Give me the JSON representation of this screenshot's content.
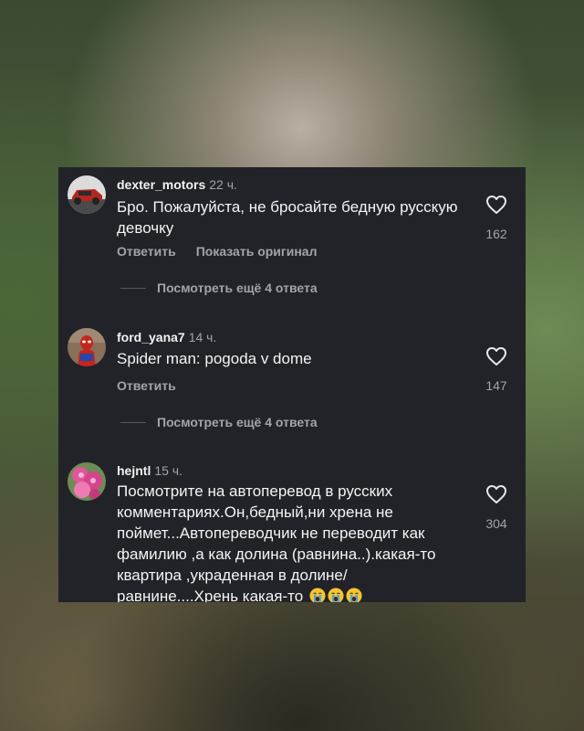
{
  "comments": [
    {
      "username": "dexter_motors",
      "time": "22 ч.",
      "text": "Бро. Пожалуйста, не бросайте бедную русскую девочку",
      "reply_label": "Ответить",
      "translate_label": "Показать оригинал",
      "like_count": "162",
      "view_replies": "Посмотреть ещё 4 ответа",
      "avatar": "car-avatar"
    },
    {
      "username": "ford_yana7",
      "time": "14 ч.",
      "text": "Spider man: pogoda v dome",
      "reply_label": "Ответить",
      "like_count": "147",
      "view_replies": "Посмотреть ещё 4 ответа",
      "avatar": "spiderman-avatar"
    },
    {
      "username": "hejntl",
      "time": "15 ч.",
      "text": "Посмотрите на автоперевод в русских комментариях.Он,бедный,ни хрена не поймет...Автопереводчик не переводит как фамилию ,а как долина (равнина..).какая-то квартира ,украденная в долине/ равнине....Хрень какая-то",
      "emojis": [
        "loudly-crying-face",
        "loudly-crying-face",
        "loudly-crying-face"
      ],
      "like_count": "304",
      "avatar": "flowers-avatar"
    }
  ],
  "colors": {
    "card_background": "#212328",
    "primary_text": "#f4f4f4",
    "secondary_text": "#a3a3a8"
  }
}
